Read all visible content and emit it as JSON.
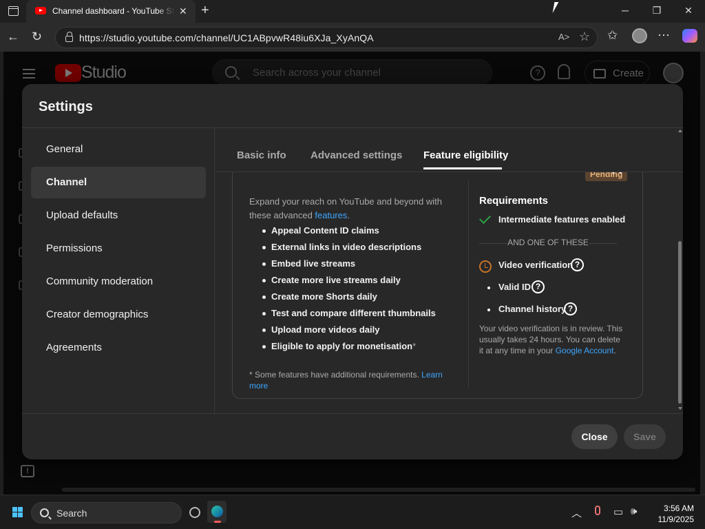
{
  "browser": {
    "tab_title": "Channel dashboard - YouTube Studio",
    "url": "https://studio.youtube.com/channel/UC1ABpvwR48iu6XJa_XyAnQA",
    "read_aloud": "A˃"
  },
  "header": {
    "logo_text": "Studio",
    "search_placeholder": "Search across your channel",
    "create_label": "Create",
    "help_glyph": "?"
  },
  "dialog": {
    "title": "Settings",
    "nav": [
      {
        "label": "General"
      },
      {
        "label": "Channel",
        "active": true
      },
      {
        "label": "Upload defaults"
      },
      {
        "label": "Permissions"
      },
      {
        "label": "Community moderation"
      },
      {
        "label": "Creator demographics"
      },
      {
        "label": "Agreements"
      }
    ],
    "tabs": [
      {
        "label": "Basic info"
      },
      {
        "label": "Advanced settings"
      },
      {
        "label": "Feature eligibility",
        "active": true
      }
    ],
    "status_badge": "Pending",
    "intro_text": "Expand your reach on YouTube and beyond with these advanced ",
    "intro_link": "features",
    "intro_end": ".",
    "features": [
      "Appeal Content ID claims",
      "External links in video descriptions",
      "Embed live streams",
      "Create more live streams daily",
      "Create more Shorts daily",
      "Test and compare different thumbnails",
      "Upload more videos daily",
      "Eligible to apply for monetisation"
    ],
    "features_last_asterisk": "*",
    "footnote_text": "* Some features have additional requirements. ",
    "footnote_link": "Learn more",
    "requirements": {
      "title": "Requirements",
      "met": "Intermediate features enabled",
      "divider": "AND ONE OF THESE",
      "pending_item": "Video verification",
      "options": [
        "Valid ID",
        "Channel history"
      ],
      "review_text": "Your video verification is in review. This usually takes 24 hours. You can delete it at any time in your ",
      "review_link": "Google Account",
      "review_end": "."
    },
    "close_label": "Close",
    "save_label": "Save"
  },
  "taskbar": {
    "search_label": "Search",
    "time": "3:56 AM",
    "date": "11/9/2025"
  },
  "colors": {
    "accent_link": "#3ea6ff",
    "success": "#2ba640",
    "pending_badge": "#e8b27a",
    "brand_red": "#ff0000"
  }
}
